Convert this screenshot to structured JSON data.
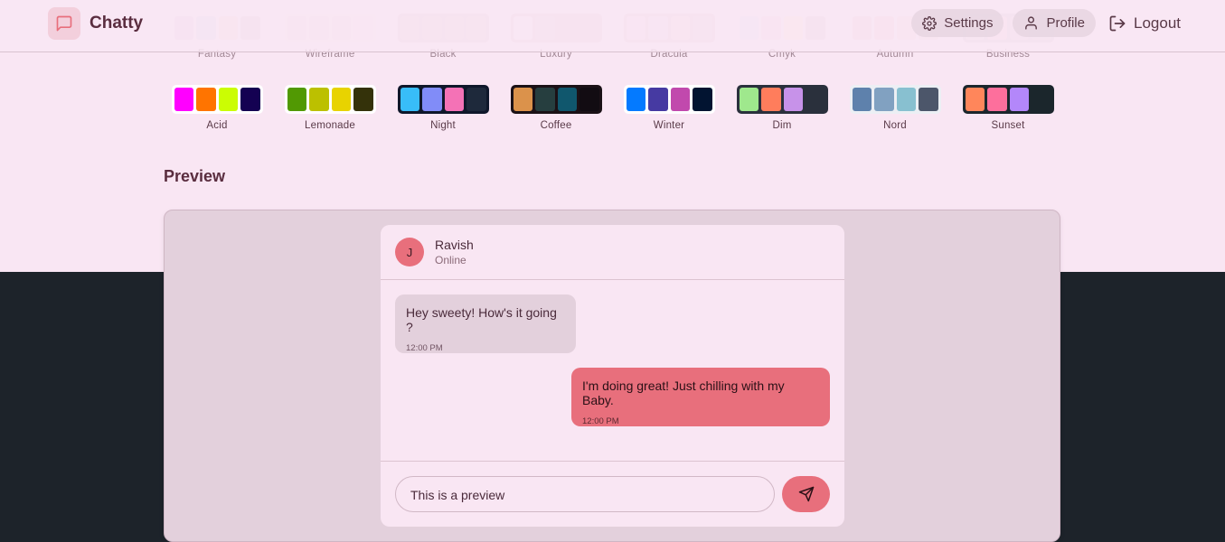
{
  "app": {
    "name": "Chatty",
    "logo_icon": "message-square-icon"
  },
  "nav": {
    "settings_label": "Settings",
    "settings_icon": "gear-icon",
    "profile_label": "Profile",
    "profile_icon": "user-icon",
    "logout_label": "Logout",
    "logout_icon": "logout-icon"
  },
  "themes_row1": [
    {
      "name": "Fantasy",
      "colors": [
        "#e2bfe0",
        "#c8d2f0",
        "#f6d7c7",
        "#d2c1d0"
      ]
    },
    {
      "name": "Wireframe",
      "colors": [
        "#ecd9e4",
        "#ecd9e4",
        "#ecd9e4",
        "#f3e2ec"
      ]
    },
    {
      "name": "Black",
      "colors": [
        "#d8c4cf",
        "#d8c4cf",
        "#d8c4cf",
        "#d8c4cf"
      ]
    },
    {
      "name": "Luxury",
      "colors": [
        "#faeef5",
        "#d9c6d2",
        "#dcc0ce",
        "#d8c0c4"
      ]
    },
    {
      "name": "Dracula",
      "colors": [
        "#f7d2ea",
        "#e9d3f1",
        "#f9dbd4",
        "#dcc6d6"
      ]
    },
    {
      "name": "Cmyk",
      "colors": [
        "#d6dcf3",
        "#f4c9dc",
        "#fbe6cf",
        "#d2bdcb"
      ]
    },
    {
      "name": "Autumn",
      "colors": [
        "#e8b9cb",
        "#f0c2ce",
        "#efd4d9",
        "#e8cfd6"
      ]
    },
    {
      "name": "Business",
      "colors": [
        "#d9d0da",
        "#f2c7d1",
        "#d9c7d1",
        "#d3c4cf"
      ]
    }
  ],
  "themes_row2": [
    {
      "name": "Acid",
      "colors": [
        "#ff00ff",
        "#ff7400",
        "#cbfd03",
        "#140152"
      ]
    },
    {
      "name": "Lemonade",
      "colors": [
        "#519903",
        "#bcc000",
        "#e8d300",
        "#34320a"
      ]
    },
    {
      "name": "Night",
      "colors": [
        "#38bdf8",
        "#818cf8",
        "#f472b6",
        "#1e293b"
      ]
    },
    {
      "name": "Coffee",
      "colors": [
        "#db924b",
        "#263e3f",
        "#10576d",
        "#120c12"
      ]
    },
    {
      "name": "Winter",
      "colors": [
        "#047aff",
        "#463aa2",
        "#c149ad",
        "#021431"
      ]
    },
    {
      "name": "Dim",
      "colors": [
        "#9fe88d",
        "#ff7d5c",
        "#c792e9",
        "#2a303c"
      ]
    },
    {
      "name": "Nord",
      "colors": [
        "#5e81ac",
        "#81a1c1",
        "#88c0d0",
        "#4c566a"
      ]
    },
    {
      "name": "Sunset",
      "colors": [
        "#ff865b",
        "#fd6f9c",
        "#b387fa",
        "#1b262c"
      ]
    }
  ],
  "preview": {
    "title": "Preview",
    "contact": {
      "initial": "J",
      "name": "Ravish",
      "status": "Online"
    },
    "messages": [
      {
        "text": "Hey sweety! How's it going ?",
        "time": "12:00 PM",
        "sent": false
      },
      {
        "text": "I'm doing great! Just chilling with my Baby.",
        "time": "12:00 PM",
        "sent": true
      }
    ],
    "input_value": "This is a preview",
    "send_icon": "send-icon"
  }
}
